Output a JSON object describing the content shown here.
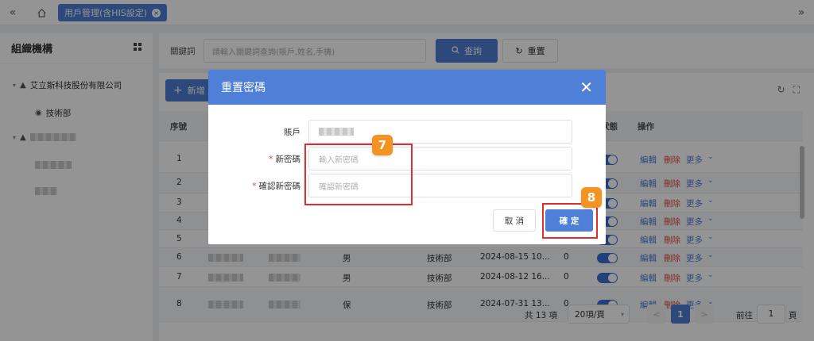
{
  "topbar": {
    "collapse_icon": "double-chevron-left-icon",
    "home_icon": "home-icon",
    "tab_label": "用戶管理(含HIS設定)",
    "expand_icon": "double-chevron-right-icon"
  },
  "org": {
    "title": "組織機構",
    "company": "艾立斯科技股份有限公司",
    "dept": "技術部"
  },
  "search": {
    "keyword_label": "關鍵詞",
    "placeholder": "請輸入關鍵詞查詢(賬戶,姓名,手機)",
    "query_label": "查詢",
    "reset_label": "重置"
  },
  "toolbar": {
    "new_label": "新增"
  },
  "table": {
    "headers": {
      "seq": "序號",
      "status": "狀態",
      "ops": "操作"
    },
    "actions": {
      "edit": "編輯",
      "delete": "刪除",
      "more": "更多"
    },
    "rows": [
      {
        "seq": "1",
        "gender": "",
        "dept": "",
        "date": "",
        "count": ""
      },
      {
        "seq": "2",
        "gender": "",
        "dept": "",
        "date": "",
        "count": ""
      },
      {
        "seq": "3",
        "gender": "",
        "dept": "",
        "date": "",
        "count": ""
      },
      {
        "seq": "4",
        "gender": "",
        "dept": "",
        "date": "",
        "count": ""
      },
      {
        "seq": "5",
        "gender": "",
        "dept": "",
        "date": "",
        "count": ""
      },
      {
        "seq": "6",
        "gender": "男",
        "dept": "技術部",
        "date": "2024-08-15 10...",
        "count": "0"
      },
      {
        "seq": "7",
        "gender": "男",
        "dept": "技術部",
        "date": "2024-08-12 16...",
        "count": "0"
      },
      {
        "seq": "8",
        "gender": "保",
        "dept": "技術部",
        "date": "2024-07-31 13...",
        "count": "0"
      }
    ]
  },
  "pager": {
    "total": "共 13 項",
    "page_size": "20項/頁",
    "current_page": "1",
    "goto_label": "前往",
    "goto_value": "1",
    "page_word": "頁"
  },
  "modal": {
    "title": "重置密碼",
    "account_label": "賬戶",
    "new_pw_label": "新密碼",
    "new_pw_placeholder": "輸入新密碼",
    "confirm_pw_label": "確認新密碼",
    "confirm_pw_placeholder": "確認新密碼",
    "required_mark": "*",
    "cancel_label": "取 消",
    "ok_label": "確 定"
  },
  "annotations": {
    "step_a": "7",
    "step_b": "8",
    "highlight_color": "#e02d2d",
    "badge_color": "#f39321"
  },
  "colors": {
    "primary": "#4f7fd6",
    "danger": "#e2483d"
  }
}
